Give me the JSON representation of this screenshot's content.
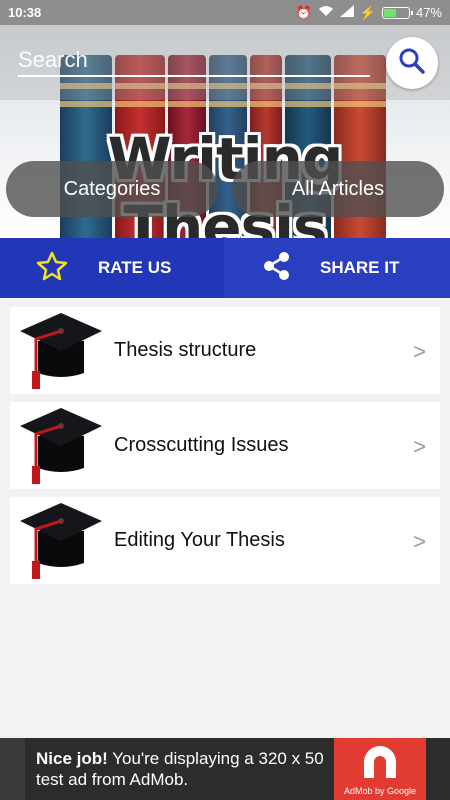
{
  "status_bar": {
    "time": "10:38",
    "battery": "47%",
    "battery_level": 0.47
  },
  "search": {
    "placeholder": "Search"
  },
  "banner": {
    "title": "Writing Thesis"
  },
  "tabs": {
    "categories": "Categories",
    "all_articles": "All Articles"
  },
  "actions": {
    "rate_label": "RATE US",
    "share_label": "SHARE IT"
  },
  "articles": [
    {
      "title": "Thesis structure"
    },
    {
      "title": "Crosscutting Issues"
    },
    {
      "title": "Editing Your Thesis"
    }
  ],
  "chevron": ">",
  "ad": {
    "bold": "Nice job!",
    "text": " You're displaying a 320 x 50 test ad from AdMob.",
    "badge": "AdMob by Google"
  },
  "colors": {
    "accent": "#2137b8",
    "star": "#f5e21b",
    "ad_red": "#e23b32"
  }
}
